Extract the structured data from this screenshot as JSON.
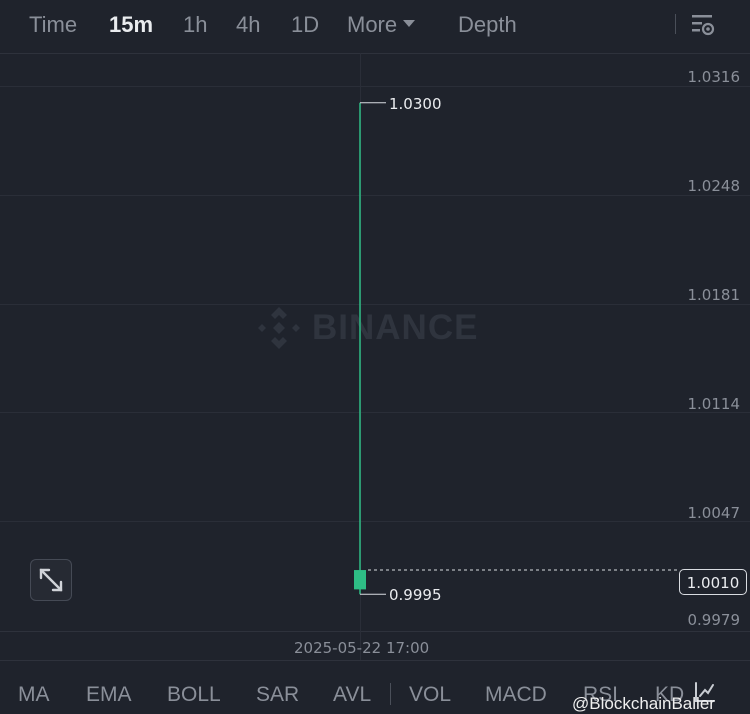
{
  "tabs": {
    "time": "Time",
    "m15": "15m",
    "h1": "1h",
    "h4": "4h",
    "d1": "1D",
    "more": "More",
    "depth": "Depth"
  },
  "price_axis": [
    "1.0316",
    "1.0248",
    "1.0181",
    "1.0114",
    "1.0047",
    "0.9979"
  ],
  "current_price": "1.0010",
  "time_label": "2025-05-22 17:00",
  "watermark": "BINANCE",
  "indicators": [
    "MA",
    "EMA",
    "BOLL",
    "SAR",
    "AVL",
    "VOL",
    "MACD",
    "RSI",
    "KD"
  ],
  "credit": "@BlockchainBaller",
  "colors": {
    "background": "#1f232c",
    "grid": "#2a2e38",
    "bull": "#2ebd85",
    "text": "#8a8f99",
    "text_active": "#eaecef"
  },
  "chart_data": {
    "type": "candlestick",
    "x": [
      "2025-05-22 17:00"
    ],
    "candles": [
      {
        "time": "2025-05-22 17:00",
        "open": 0.9998,
        "high": 1.03,
        "low": 0.9995,
        "close": 1.001
      }
    ],
    "high_label": "1.0300",
    "low_label": "0.9995",
    "y_ticks": [
      1.0316,
      1.0248,
      1.0181,
      1.0114,
      1.0047,
      0.9979
    ],
    "current_price": 1.001
  }
}
